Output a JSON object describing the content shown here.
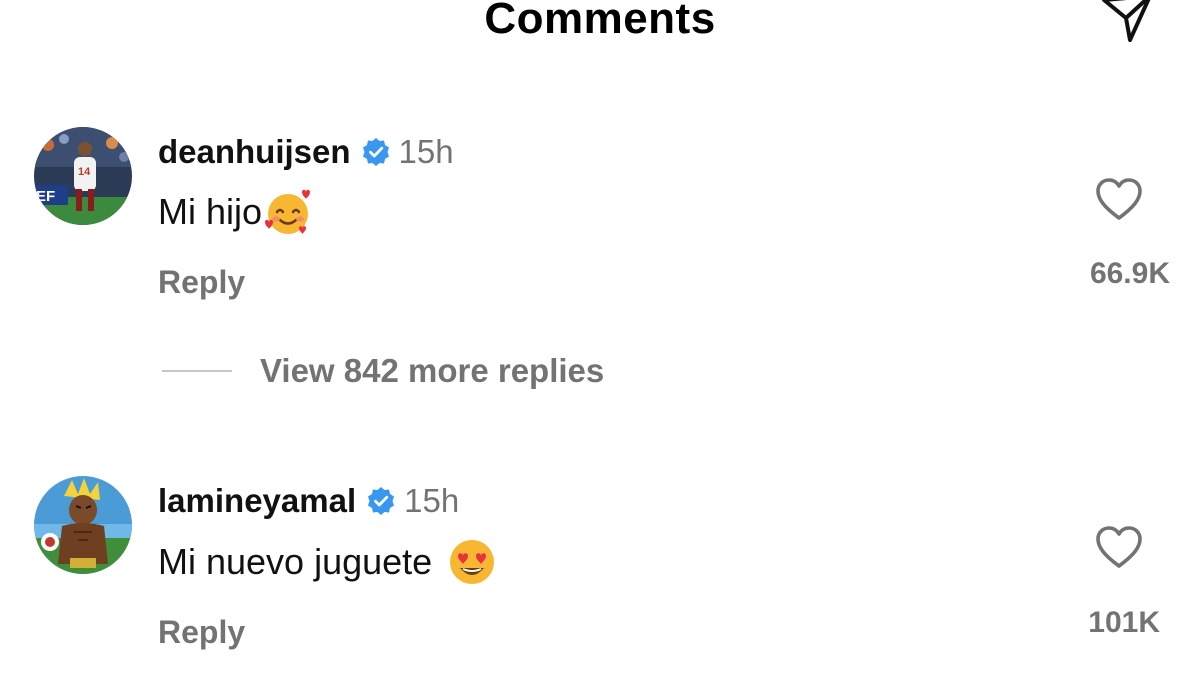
{
  "header": {
    "title": "Comments",
    "share_icon": "paper-plane-icon"
  },
  "comments": [
    {
      "username": "deanhuijsen",
      "verified": true,
      "time": "15h",
      "text": "Mi hijo",
      "emoji": "smiling-face-with-hearts",
      "reply_label": "Reply",
      "likes": "66.9K"
    },
    {
      "username": "lamineyamal",
      "verified": true,
      "time": "15h",
      "text": "Mi nuevo juguete",
      "emoji": "heart-eyes",
      "reply_label": "Reply",
      "likes": "101K"
    }
  ],
  "replies_link": {
    "label": "View 842 more replies"
  },
  "colors": {
    "secondary_text": "#737373",
    "verified_blue": "#3897f0",
    "emoji_yellow": "#f7b733",
    "heart_red": "#e8323c"
  }
}
